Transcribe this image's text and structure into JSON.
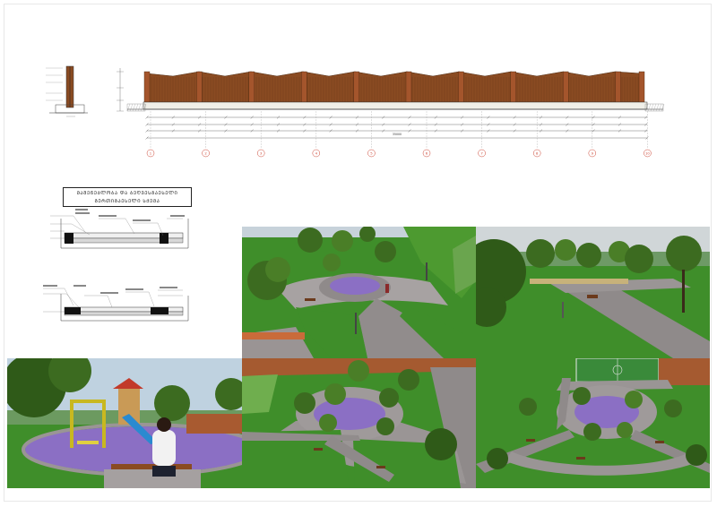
{
  "legend": {
    "line1": "ᲛᲐᲨᲔᲜᲔᲑᲚᲝᲑᲐ ᲓᲐ ᲑᲔᲦᲕᲔᲡᲒᲐᲔᲡᲔᲚᲘ",
    "line2": "ᲒᲔᲠᲗᲘᲒᲐᲔᲡᲔᲚᲘ ᲡᲥᲔᲛᲐ"
  },
  "fence_elevation": {
    "axis_labels": [
      "1",
      "2",
      "3",
      "4",
      "5",
      "6",
      "7",
      "8",
      "9",
      "10"
    ],
    "total_dimension": "35000"
  },
  "renders": [
    {
      "view": "aerial-oblique-park"
    },
    {
      "view": "garden-path-eye-level"
    },
    {
      "view": "playground-eye-level"
    },
    {
      "view": "plaza-aerial-top"
    },
    {
      "view": "site-aerial-with-pitch"
    }
  ],
  "colors": {
    "fence_wood": "#8a4b22",
    "fence_post": "#a4552c",
    "grass": "#3f8e2a",
    "paving": "#8f8a8a",
    "plaza_purple": "#8b6fc4",
    "sky": "#c9d4da",
    "tree": "#3c6b20"
  }
}
